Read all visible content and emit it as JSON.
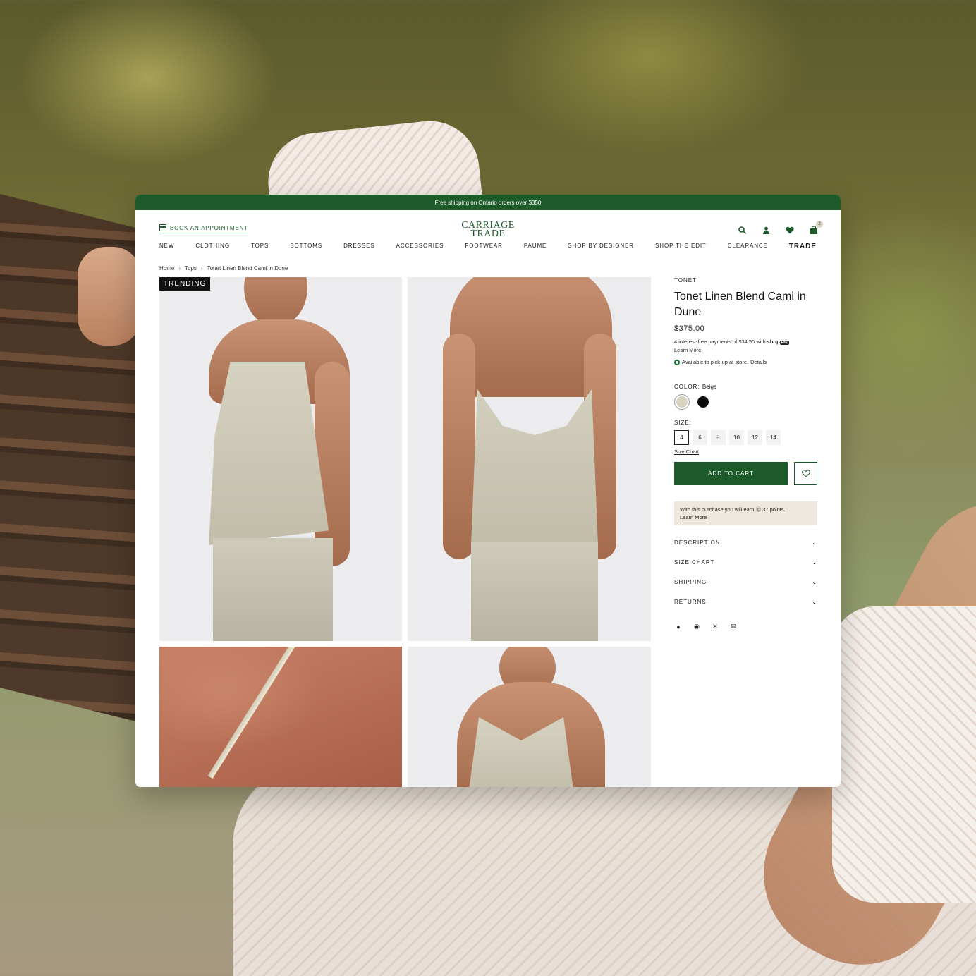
{
  "promo": "Free shipping on Ontario orders over $350",
  "header": {
    "appointment": "BOOK AN APPOINTMENT",
    "logo_line1": "CARRIAGE",
    "logo_line2": "TRADE",
    "cart_count": "2"
  },
  "nav": [
    "NEW",
    "CLOTHING",
    "TOPS",
    "BOTTOMS",
    "DRESSES",
    "ACCESSORIES",
    "FOOTWEAR",
    "PAUME",
    "SHOP BY DESIGNER",
    "SHOP THE EDIT",
    "CLEARANCE",
    "TRADE"
  ],
  "breadcrumb": [
    "Home",
    "Tops",
    "Tonet Linen Blend Cami in Dune"
  ],
  "gallery": {
    "badge": "TRENDING"
  },
  "product": {
    "brand": "TONET",
    "title": "Tonet Linen Blend Cami in Dune",
    "price": "$375.00",
    "installments": "4 interest-free payments of $34.50 with",
    "shop_word": "shop",
    "pay_word": "Pay",
    "learn_more": "Learn More",
    "pickup": "Available to pick-up at store.",
    "details": "Details",
    "color_label": "COLOR:",
    "color_value": "Beige",
    "colors": [
      "#d9d3c0",
      "#0a0a0a"
    ],
    "size_label": "SIZE:",
    "sizes": [
      "4",
      "6",
      "8",
      "10",
      "12",
      "14"
    ],
    "size_chart": "Size Chart",
    "add_to_cart": "ADD TO CART",
    "points_text": "With this purchase you will earn",
    "points_value": "37 points.",
    "points_learn": "Learn More",
    "accordions": [
      "DESCRIPTION",
      "SIZE CHART",
      "SHIPPING",
      "RETURNS"
    ]
  },
  "colors": {
    "brand_green": "#1d5a2a",
    "points_bg": "#efe8df"
  }
}
